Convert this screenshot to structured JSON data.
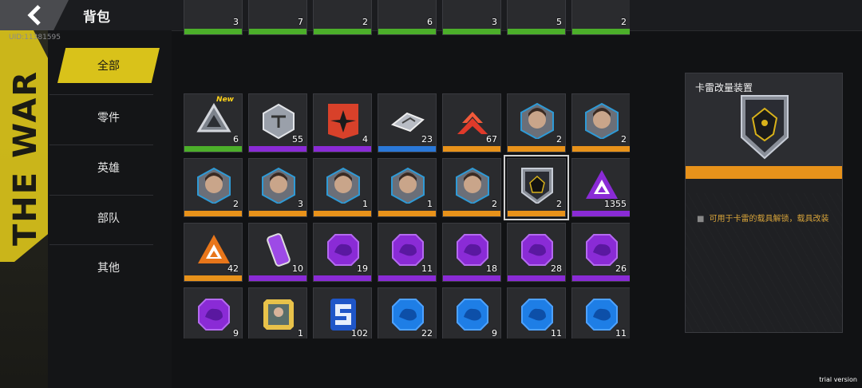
{
  "header": {
    "title": "背包",
    "back_icon": "back-arrow-icon",
    "uid": "UID:11381595"
  },
  "sidebar": {
    "decor_text": "THE WAR",
    "items": [
      {
        "label": "全部",
        "active": true
      },
      {
        "label": "零件",
        "active": false
      },
      {
        "label": "英雄",
        "active": false
      },
      {
        "label": "部队",
        "active": false
      },
      {
        "label": "其他",
        "active": false
      }
    ]
  },
  "rarity_colors": {
    "green": "#4caf2a",
    "purple": "#8a2bd6",
    "blue": "#2a78d8",
    "orange": "#e8921a"
  },
  "inventory": {
    "rows": [
      [
        {
          "qty": "3",
          "rarity": "green"
        },
        {
          "qty": "7",
          "rarity": "green"
        },
        {
          "qty": "2",
          "rarity": "green"
        },
        {
          "qty": "6",
          "rarity": "green"
        },
        {
          "qty": "3",
          "rarity": "green"
        },
        {
          "qty": "5",
          "rarity": "green"
        },
        {
          "qty": "2",
          "rarity": "green"
        }
      ],
      [
        {
          "qty": "6",
          "rarity": "green",
          "icon": "triangle-core-icon",
          "new": true
        },
        {
          "qty": "55",
          "rarity": "purple",
          "icon": "hex-crate-icon"
        },
        {
          "qty": "4",
          "rarity": "purple",
          "icon": "red-banner-icon"
        },
        {
          "qty": "23",
          "rarity": "blue",
          "icon": "metal-parts-icon"
        },
        {
          "qty": "67",
          "rarity": "orange",
          "icon": "red-chevron-icon"
        },
        {
          "qty": "2",
          "rarity": "orange",
          "icon": "hero-portrait-icon"
        },
        {
          "qty": "2",
          "rarity": "orange",
          "icon": "hero-portrait-icon"
        }
      ],
      [
        {
          "qty": "2",
          "rarity": "orange",
          "icon": "hero-portrait-icon"
        },
        {
          "qty": "3",
          "rarity": "orange",
          "icon": "hero-portrait-icon"
        },
        {
          "qty": "1",
          "rarity": "orange",
          "icon": "hero-portrait-icon"
        },
        {
          "qty": "1",
          "rarity": "orange",
          "icon": "hero-portrait-icon"
        },
        {
          "qty": "2",
          "rarity": "orange",
          "icon": "hero-portrait-icon"
        },
        {
          "qty": "2",
          "rarity": "orange",
          "icon": "mech-upgrade-icon",
          "selected": true
        },
        {
          "qty": "1355",
          "rarity": "purple",
          "icon": "purple-triangle-icon"
        }
      ],
      [
        {
          "qty": "42",
          "rarity": "orange",
          "icon": "orange-triangle-icon"
        },
        {
          "qty": "10",
          "rarity": "purple",
          "icon": "canister-icon"
        },
        {
          "qty": "19",
          "rarity": "purple",
          "icon": "purple-unit-chip-icon"
        },
        {
          "qty": "11",
          "rarity": "purple",
          "icon": "purple-unit-chip-icon"
        },
        {
          "qty": "18",
          "rarity": "purple",
          "icon": "purple-unit-chip-icon"
        },
        {
          "qty": "28",
          "rarity": "purple",
          "icon": "purple-unit-chip-icon"
        },
        {
          "qty": "26",
          "rarity": "purple",
          "icon": "purple-unit-chip-icon"
        }
      ],
      [
        {
          "qty": "9",
          "rarity": "purple",
          "icon": "purple-unit-chip-icon"
        },
        {
          "qty": "1",
          "rarity": "purple",
          "icon": "ticket-icon"
        },
        {
          "qty": "102",
          "rarity": "blue",
          "icon": "blue-code-icon"
        },
        {
          "qty": "22",
          "rarity": "blue",
          "icon": "blue-unit-chip-icon"
        },
        {
          "qty": "9",
          "rarity": "blue",
          "icon": "blue-unit-chip-icon"
        },
        {
          "qty": "11",
          "rarity": "blue",
          "icon": "blue-unit-chip-icon"
        },
        {
          "qty": "11",
          "rarity": "blue",
          "icon": "blue-unit-chip-icon"
        }
      ]
    ],
    "new_label": "New"
  },
  "detail": {
    "name": "卡雷改量装置",
    "icon": "mech-upgrade-icon",
    "rarity": "orange",
    "description": "可用于卡雷的载具解锁，载具改装"
  },
  "watermark": "trial version"
}
